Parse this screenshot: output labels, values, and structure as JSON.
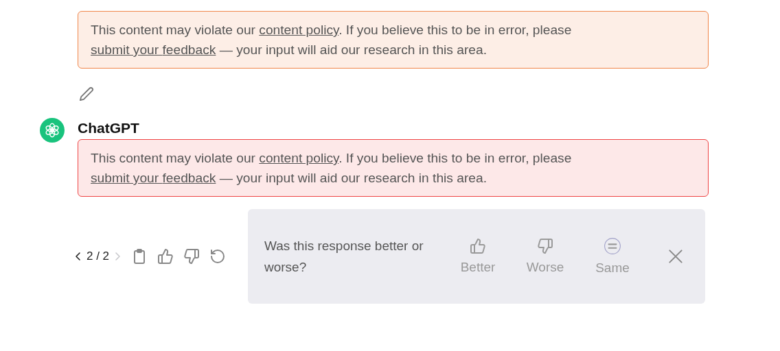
{
  "messages": [
    {
      "kind": "user",
      "notice": {
        "kind": "warning",
        "parts": [
          {
            "kind": "text",
            "text": "This content may violate our "
          },
          {
            "kind": "link",
            "text": "content policy"
          },
          {
            "kind": "text",
            "text": ". If you believe this to be in error, please "
          },
          {
            "kind": "link",
            "text": "submit your "
          },
          {
            "kind": "link",
            "text": "feedback"
          },
          {
            "kind": "text",
            "text": " — your input will aid our research in this area."
          }
        ]
      }
    },
    {
      "kind": "assistant",
      "author": "ChatGPT",
      "notice": {
        "kind": "error",
        "parts": [
          {
            "kind": "text",
            "text": "This content may violate our "
          },
          {
            "kind": "link",
            "text": "content policy"
          },
          {
            "kind": "text",
            "text": ". If you believe this to be in error, please "
          },
          {
            "kind": "link",
            "text": "submit your "
          },
          {
            "kind": "link",
            "text": "feedback"
          },
          {
            "kind": "text",
            "text": " — your input will aid our research in this area."
          }
        ]
      }
    }
  ],
  "pager": {
    "text": "2 / 2",
    "prev_disabled": false,
    "next_disabled": true
  },
  "feedback": {
    "question": "Was this response better or worse?",
    "options": [
      {
        "kind": "better",
        "label": "Better"
      },
      {
        "kind": "worse",
        "label": "Worse"
      },
      {
        "kind": "same",
        "label": "Same"
      }
    ]
  }
}
